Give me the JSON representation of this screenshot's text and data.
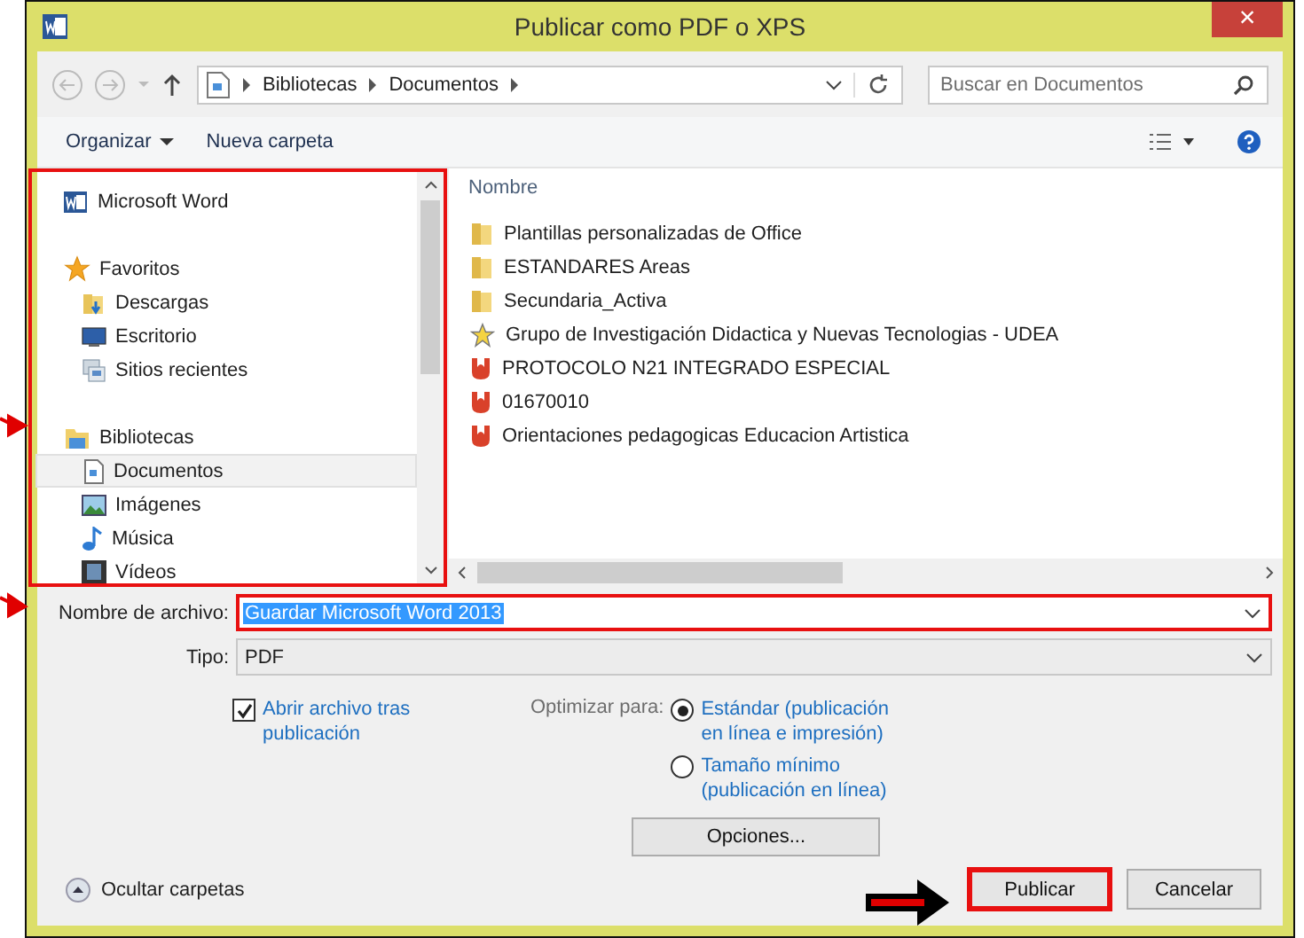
{
  "window": {
    "title": "Publicar como PDF o XPS",
    "close": "×"
  },
  "address": {
    "path": [
      "Bibliotecas",
      "Documentos"
    ]
  },
  "search": {
    "placeholder": "Buscar en Documentos"
  },
  "toolbar": {
    "organize": "Organizar",
    "new_folder": "Nueva carpeta"
  },
  "nav": [
    {
      "label": "Microsoft Word",
      "kind": "app",
      "selected": false
    },
    {
      "label": "Favoritos",
      "kind": "group",
      "selected": false
    },
    {
      "label": "Descargas",
      "kind": "downloads",
      "selected": false
    },
    {
      "label": "Escritorio",
      "kind": "desktop",
      "selected": false
    },
    {
      "label": "Sitios recientes",
      "kind": "recent",
      "selected": false
    },
    {
      "label": "Bibliotecas",
      "kind": "libraries",
      "selected": false
    },
    {
      "label": "Documentos",
      "kind": "documents",
      "selected": true
    },
    {
      "label": "Imágenes",
      "kind": "pictures",
      "selected": false
    },
    {
      "label": "Música",
      "kind": "music",
      "selected": false
    },
    {
      "label": "Vídeos",
      "kind": "videos",
      "selected": false
    }
  ],
  "files": {
    "column": "Nombre",
    "items": [
      {
        "name": "Plantillas personalizadas de Office",
        "kind": "folder"
      },
      {
        "name": "ESTANDARES Areas",
        "kind": "folder"
      },
      {
        "name": "Secundaria_Activa",
        "kind": "folder"
      },
      {
        "name": "Grupo de Investigación Didactica y Nuevas Tecnologias - UDEA",
        "kind": "favorite"
      },
      {
        "name": "PROTOCOLO N21 INTEGRADO ESPECIAL",
        "kind": "pdf"
      },
      {
        "name": "01670010",
        "kind": "pdf"
      },
      {
        "name": "Orientaciones pedagogicas Educacion Artistica",
        "kind": "pdf"
      }
    ]
  },
  "filename": {
    "label": "Nombre de archivo:",
    "value": "Guardar Microsoft Word 2013"
  },
  "type": {
    "label": "Tipo:",
    "value": "PDF"
  },
  "open_after": {
    "label": "Abrir archivo tras publicación",
    "checked": true
  },
  "optimize": {
    "label": "Optimizar para:",
    "options": [
      {
        "label": "Estándar (publicación en línea e impresión)",
        "selected": true
      },
      {
        "label": "Tamaño mínimo (publicación en línea)",
        "selected": false
      }
    ]
  },
  "options_button": "Opciones...",
  "hide_folders": "Ocultar carpetas",
  "buttons": [
    "Publicar",
    "Cancelar"
  ]
}
